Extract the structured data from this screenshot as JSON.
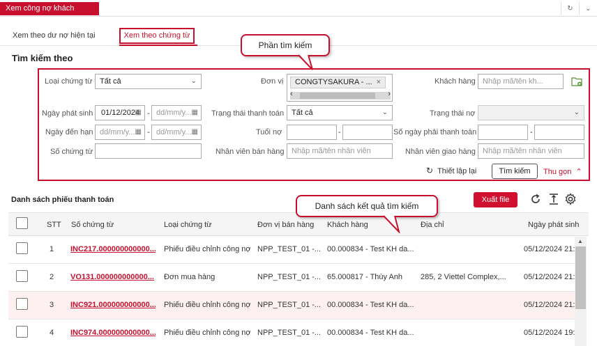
{
  "header": {
    "title": "Xem công nợ khách hàng",
    "icons": [
      "refresh-icon",
      "chevron-down-icon"
    ]
  },
  "view_tabs": [
    "Xem theo dư nợ hiện tại",
    "Xem theo chứng từ"
  ],
  "search": {
    "title": "Tìm kiếm theo",
    "doc_type": {
      "label": "Loại chứng từ",
      "value": "Tất cả"
    },
    "unit": {
      "label": "Đơn vị",
      "value": "CONGTYSAKURA - ..."
    },
    "customer": {
      "label": "Khách hàng",
      "placeholder": "Nhập mã/tên kh..."
    },
    "issue_date": {
      "label": "Ngày phát sinh",
      "from": "01/12/2024",
      "to": "dd/mm/y..."
    },
    "settle_status": {
      "label": "Trạng thái thanh toán",
      "value": "Tất cả"
    },
    "debt_status": {
      "label": "Trạng thái nợ",
      "value": ""
    },
    "due_date": {
      "label": "Ngày đến hạn",
      "from": "dd/mm/y...",
      "to": "dd/mm/y..."
    },
    "debt_age": {
      "label": "Tuổi nợ"
    },
    "days_due": {
      "label": "Số ngày phải thanh toán"
    },
    "doc_no": {
      "label": "Số chứng từ"
    },
    "sales_staff": {
      "label": "Nhân viên bán hàng",
      "placeholder": "Nhập mã/tên nhân viên"
    },
    "delivery_staff": {
      "label": "Nhân viên giao hàng",
      "placeholder": "Nhập mã/tên nhân viên"
    },
    "reset": "Thiết lập lại",
    "search_btn": "Tìm kiếm",
    "collapse": "Thu gọn"
  },
  "callouts": {
    "search": "Phần tìm kiếm",
    "results": "Danh sách kết quả tìm kiếm"
  },
  "list": {
    "title": "Danh sách phiếu thanh toán",
    "export": "Xuất file",
    "columns": [
      "STT",
      "Số chứng từ",
      "Loại chứng từ",
      "Đơn vị bán hàng",
      "Khách hàng",
      "Địa chỉ",
      "Ngày phát sinh"
    ],
    "rows": [
      {
        "stt": "1",
        "doc": "INC217.000000000000...",
        "type": "Phiếu điều chỉnh công nợ",
        "unit": "NPP_TEST_01 -...",
        "customer": "00.000834 - Test KH da...",
        "address": "",
        "date": "05/12/2024 21:..."
      },
      {
        "stt": "2",
        "doc": "VO131.000000000000...",
        "type": "Đơn mua hàng",
        "unit": "NPP_TEST_01 -...",
        "customer": "65.000817 - Thùy Anh",
        "address": "285, 2 Viettel Complex,...",
        "date": "05/12/2024 21:..."
      },
      {
        "stt": "3",
        "doc": "INC921.000000000000...",
        "type": "Phiếu điều chỉnh công nợ",
        "unit": "NPP_TEST_01 -...",
        "customer": "00.000834 - Test KH da...",
        "address": "",
        "date": "05/12/2024 21:..."
      },
      {
        "stt": "4",
        "doc": "INC974.000000000000...",
        "type": "Phiếu điều chỉnh công nợ",
        "unit": "NPP_TEST_01 -...",
        "customer": "00.000834 - Test KH da...",
        "address": "",
        "date": "05/12/2024 19:..."
      }
    ]
  }
}
